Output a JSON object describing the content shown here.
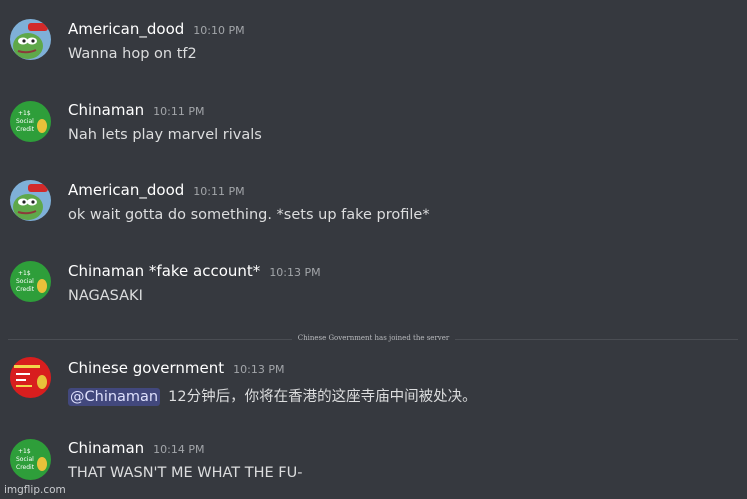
{
  "messages": [
    {
      "username": "American_dood",
      "timestamp": "10:10 PM",
      "text": "Wanna hop on tf2",
      "avatar": "pepe-avatar"
    },
    {
      "username": "Chinaman",
      "timestamp": "10:11 PM",
      "text": "Nah lets play marvel rivals",
      "avatar": "social-credit-avatar"
    },
    {
      "username": "American_dood",
      "timestamp": "10:11 PM",
      "text": "ok wait gotta do something. *sets up fake profile*",
      "avatar": "pepe-avatar"
    },
    {
      "username": "Chinaman *fake account*",
      "timestamp": "10:13 PM",
      "text": "NAGASAKI",
      "avatar": "social-credit-avatar"
    },
    {
      "username": "Chinese government",
      "timestamp": "10:13 PM",
      "mention": "@Chinaman",
      "text": "12分钟后，你将在香港的这座寺庙中间被处决。",
      "avatar": "red-social-credit-avatar"
    },
    {
      "username": "Chinaman",
      "timestamp": "10:14 PM",
      "text": "THAT WASN'T ME WHAT THE FU-",
      "avatar": "social-credit-avatar"
    }
  ],
  "system_notice": "Chinese Government has joined the server",
  "avatar_badges": {
    "plus": "+1$",
    "social": "Social",
    "credit": "Credit"
  },
  "watermark": "imgflip.com",
  "colors": {
    "background": "#36393f",
    "username": "#ffffff",
    "message_text": "#dcddde",
    "timestamp": "#a3a6aa",
    "mention_bg": "#4e55a3",
    "green_avatar": "#2e9e3a",
    "red_avatar": "#d81e1e"
  }
}
